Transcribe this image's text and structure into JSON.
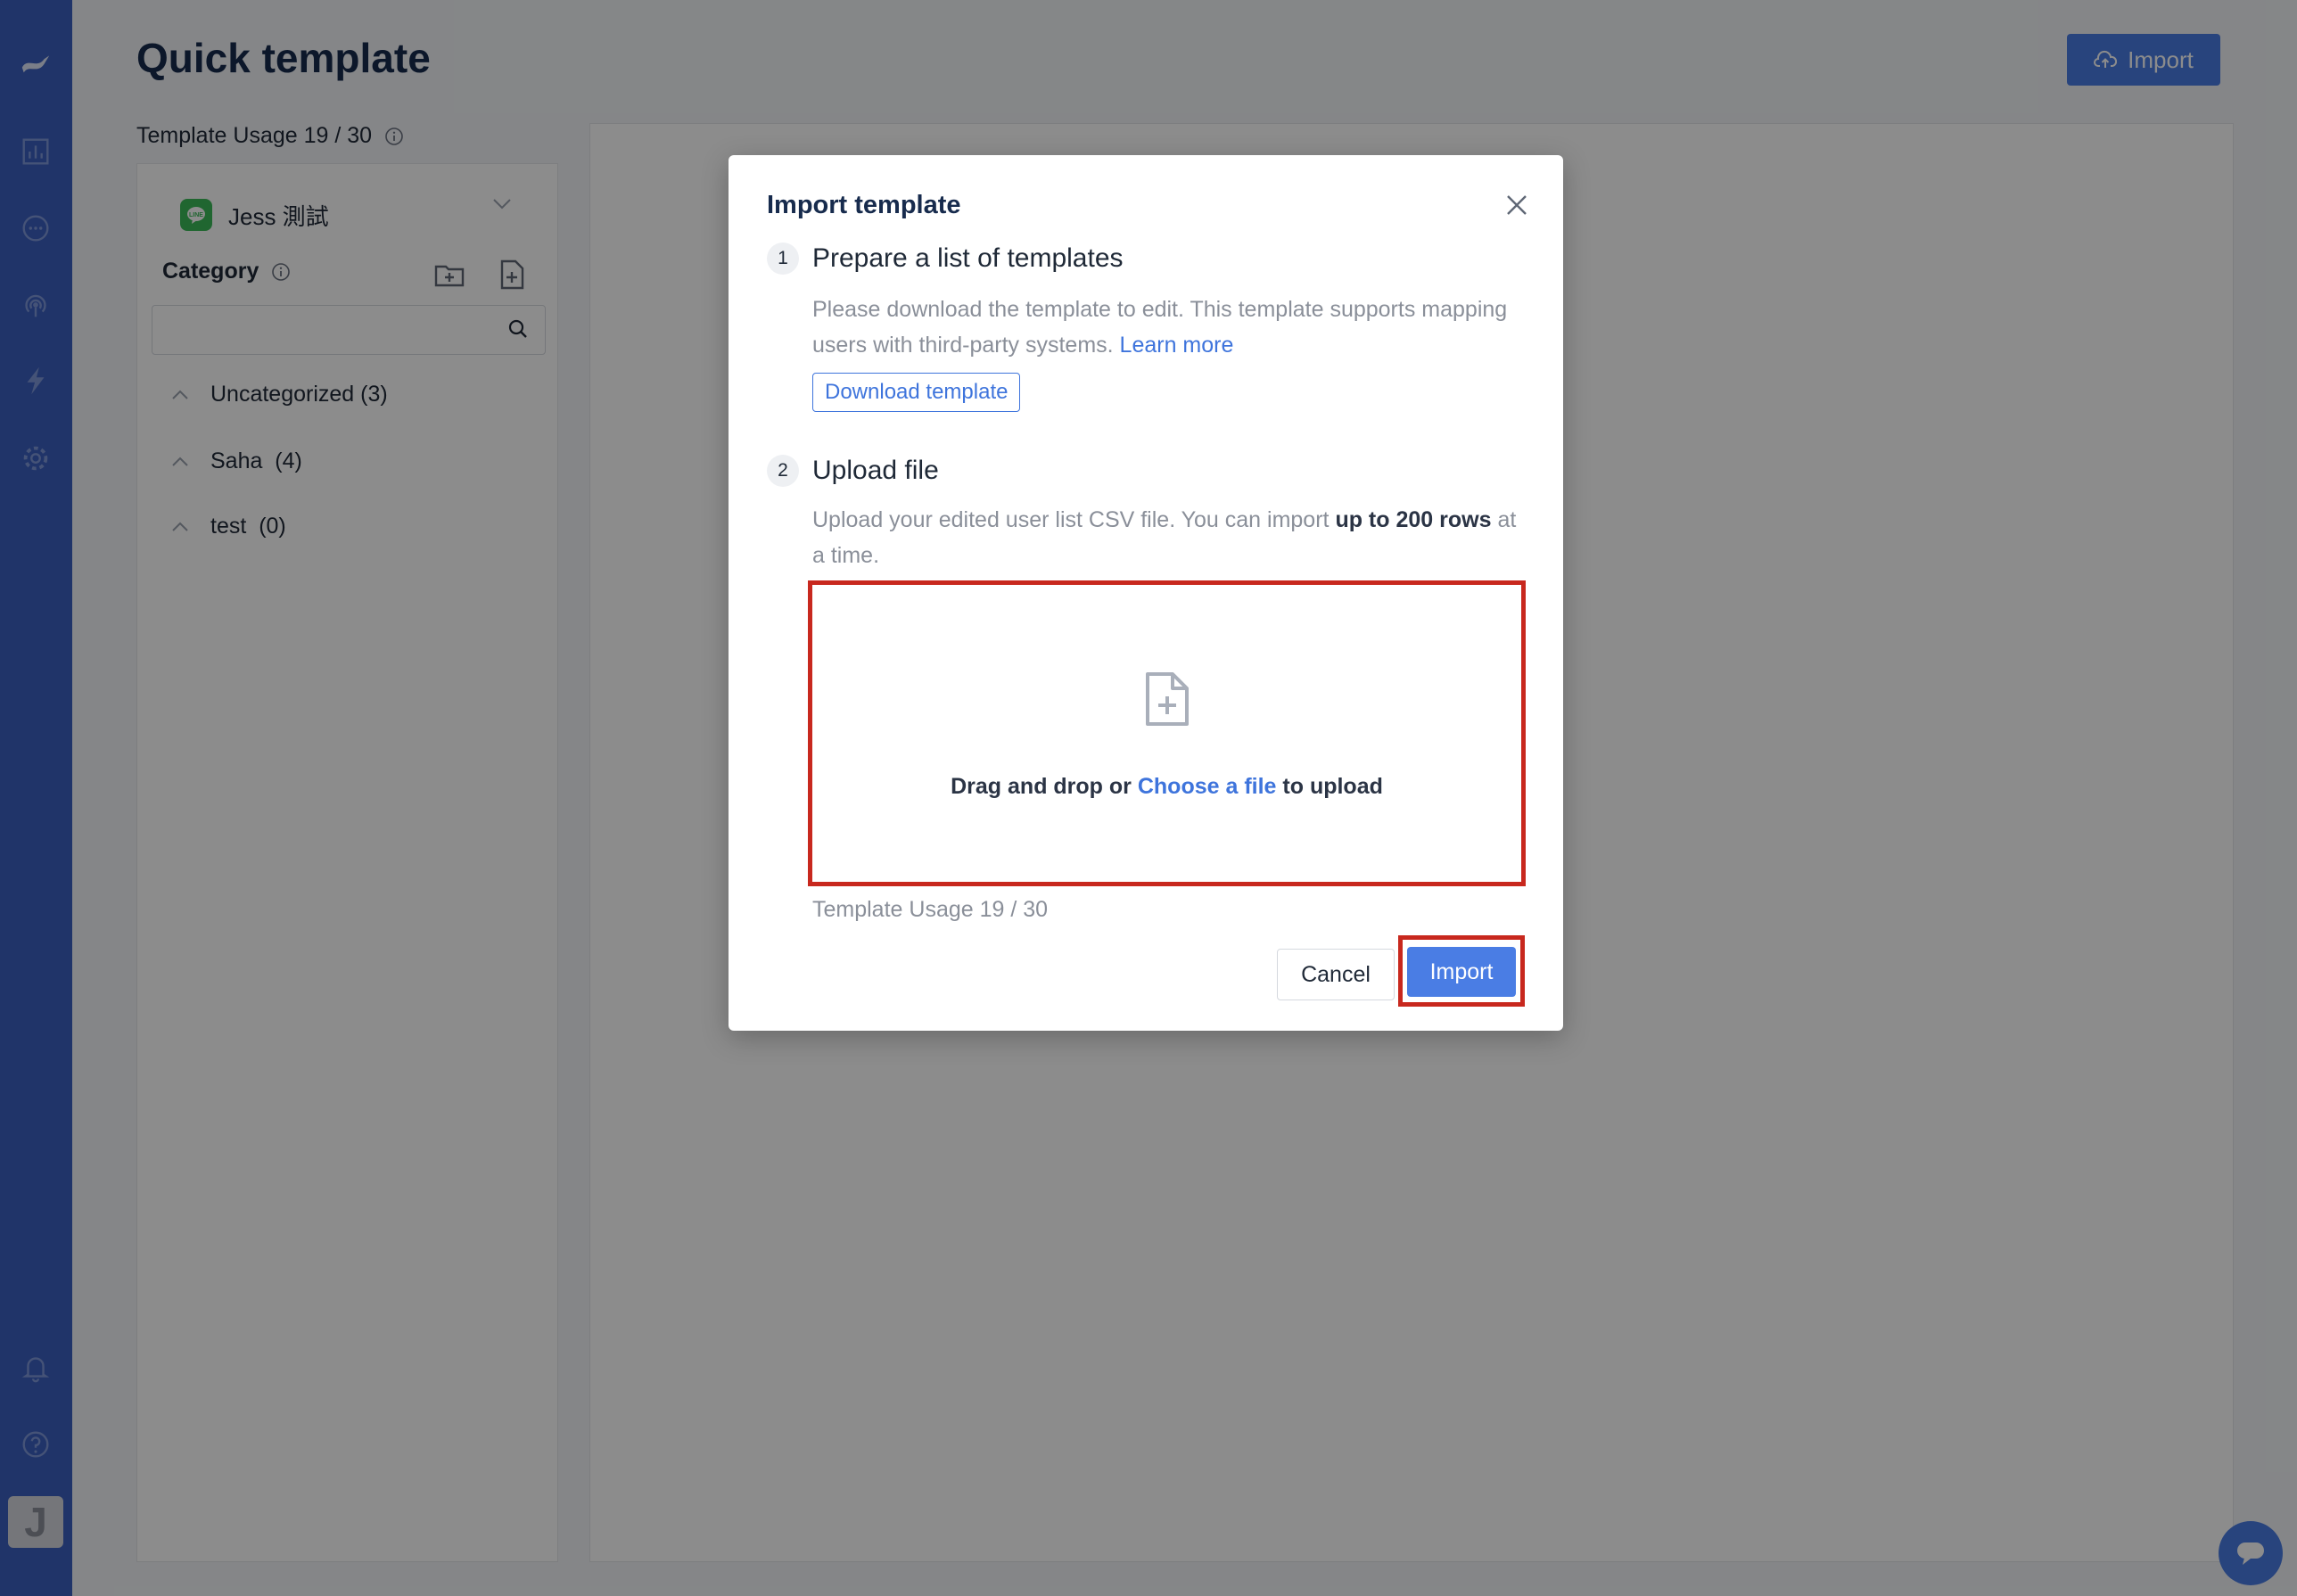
{
  "page": {
    "title": "Quick template",
    "import_label": "Import",
    "usage_label": "Template Usage 19 / 30"
  },
  "left_panel": {
    "channel_name": "Jess 測試",
    "category_label": "Category",
    "search_placeholder": "",
    "categories": [
      {
        "name": "Uncategorized",
        "count": "(3)"
      },
      {
        "name": "Saha",
        "count": "(4)"
      },
      {
        "name": "test",
        "count": "(0)"
      }
    ]
  },
  "sidebar": {
    "avatar_letter": "J",
    "icons": [
      "logo-icon",
      "analytics-icon",
      "chat-icon",
      "broadcast-icon",
      "automation-icon",
      "settings-icon",
      "notification-icon",
      "help-icon"
    ]
  },
  "modal": {
    "title": "Import template",
    "step1": {
      "number": "1",
      "title": "Prepare a list of templates",
      "desc": "Please download the template to edit. This template supports mapping users with third-party systems.",
      "learn_more": "Learn more",
      "download_label": "Download template"
    },
    "step2": {
      "number": "2",
      "title": "Upload file",
      "desc_pre": "Upload your edited user list CSV file. You can import",
      "desc_bold": "up to 200 rows",
      "desc_post": "at a time."
    },
    "dropzone": {
      "pre": "Drag and drop or",
      "link": "Choose a file",
      "post": "to upload"
    },
    "usage_label": "Template Usage 19 / 30",
    "cancel_label": "Cancel",
    "import_label": "Import"
  },
  "colors": {
    "sidebar": "#3b5fc0",
    "primary": "#4a7de4",
    "link": "#3e74dc",
    "highlight": "#c8281e",
    "line_green": "#3bba58"
  }
}
